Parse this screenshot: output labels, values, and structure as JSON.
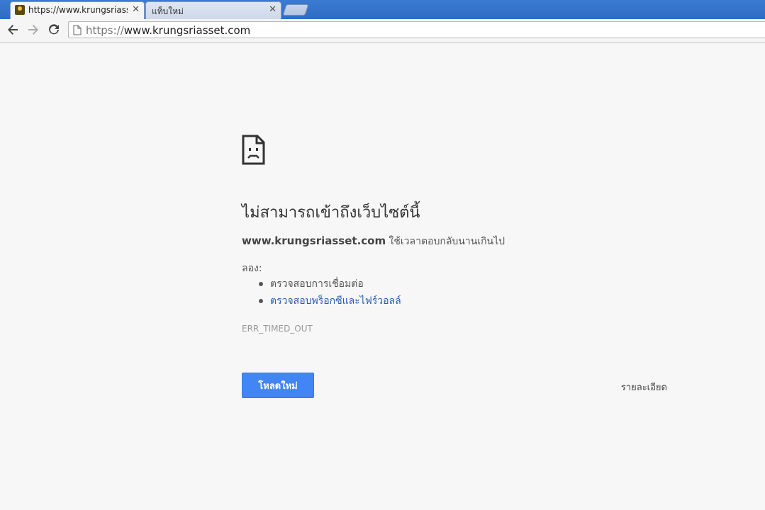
{
  "tabs": [
    {
      "title": "https://www.krungsriasset",
      "close": "✕"
    },
    {
      "title": "แท็บใหม่",
      "close": "✕"
    }
  ],
  "toolbar": {
    "url_scheme": "https://",
    "url_host": "www.krungsriasset.com"
  },
  "error": {
    "heading": "ไม่สามารถเข้าถึงเว็บไซต์นี้",
    "site": "www.krungsriasset.com",
    "message": " ใช้เวลาตอบกลับนานเกินไป",
    "try_label": "ลอง:",
    "suggestions": [
      "ตรวจสอบการเชื่อมต่อ",
      "ตรวจสอบพร็อกซีและไฟร์วอลล์"
    ],
    "code": "ERR_TIMED_OUT",
    "reload_label": "โหลดใหม่",
    "details_label": "รายละเอียด"
  },
  "colors": {
    "accent": "#4285f4",
    "link": "#2a5db0",
    "tabstrip": "#2f6cc4"
  }
}
